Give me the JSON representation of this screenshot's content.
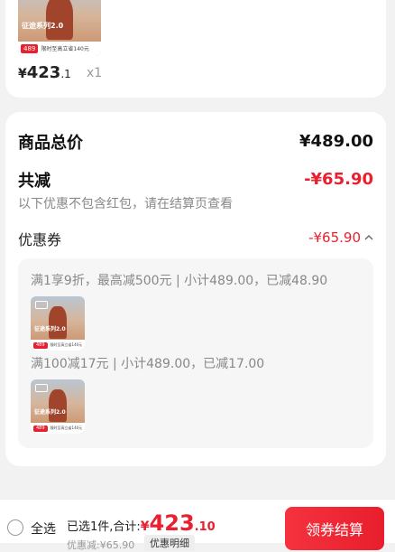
{
  "top_item": {
    "thumb": {
      "series_text": "征途系列2.0",
      "price_tag": "489",
      "tag_text": "限时至高立省140元"
    },
    "price_symbol": "¥",
    "price_int": "423",
    "price_dec": ".1",
    "quantity": "x1"
  },
  "summary": {
    "total_label": "商品总价",
    "total_value": "¥489.00",
    "discount_label": "共减",
    "discount_value": "-¥65.90",
    "discount_note": "以下优惠不包含红包，请在结算页查看",
    "coupon_label": "优惠券",
    "coupon_value": "-¥65.90",
    "promos": [
      {
        "text": "满1享9折，最高减500元 | 小计489.00，已减48.90",
        "thumb": {
          "series_text": "征途系列2.0",
          "price_tag": "489",
          "tag_text": "限时至高立省140元"
        }
      },
      {
        "text": "满100减17元 | 小计489.00，已减17.00",
        "thumb": {
          "series_text": "征途系列2.0",
          "price_tag": "489",
          "tag_text": "限时至高立省140元"
        }
      }
    ]
  },
  "bottom_bar": {
    "select_all_label": "全选",
    "selected_text": "已选1件,合计:",
    "total_symbol": "¥",
    "total_int": "423",
    "total_dec": ".10",
    "discount_detail": "优惠减:¥65.90",
    "detail_button": "优惠明细",
    "checkout_button": "领券结算"
  },
  "colors": {
    "accent_red": "#e8202f",
    "muted_text": "#888888"
  }
}
